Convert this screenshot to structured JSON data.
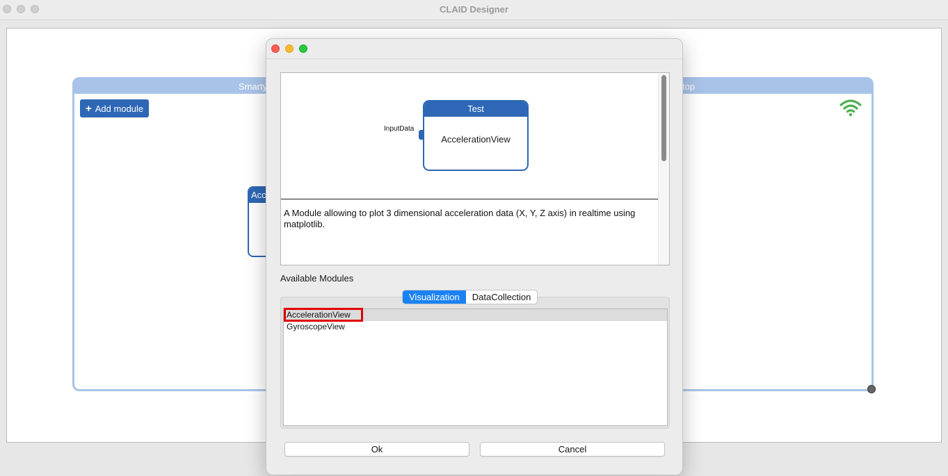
{
  "window": {
    "title": "CLAID Designer"
  },
  "device": {
    "name_left_fragment": "Smarty",
    "name_right_fragment": "top",
    "add_module_label": "Add module",
    "wifi_color": "#4caf50",
    "background_module_header": "Acc"
  },
  "dialog": {
    "preview": {
      "module_header": "Test",
      "module_name": "AccelerationView",
      "input_port_label": "InputData",
      "description": "A Module allowing to plot 3 dimensional acceleration data (X, Y, Z axis) in realtime using matplotlib."
    },
    "available_modules_label": "Available Modules",
    "tabs": [
      {
        "label": "Visualization",
        "active": true
      },
      {
        "label": "DataCollection",
        "active": false
      }
    ],
    "modules": [
      {
        "label": "AccelerationView",
        "selected": true
      },
      {
        "label": "GyroscopeView",
        "selected": false
      }
    ],
    "ok_label": "Ok",
    "cancel_label": "Cancel"
  },
  "colors": {
    "accent": "#2d67b5",
    "device_border": "#a9c3e8",
    "tab_active": "#1a82f5",
    "highlight": "#e00000",
    "close": "#fe5f57",
    "minimize": "#febc2e",
    "maximize": "#28c840"
  }
}
